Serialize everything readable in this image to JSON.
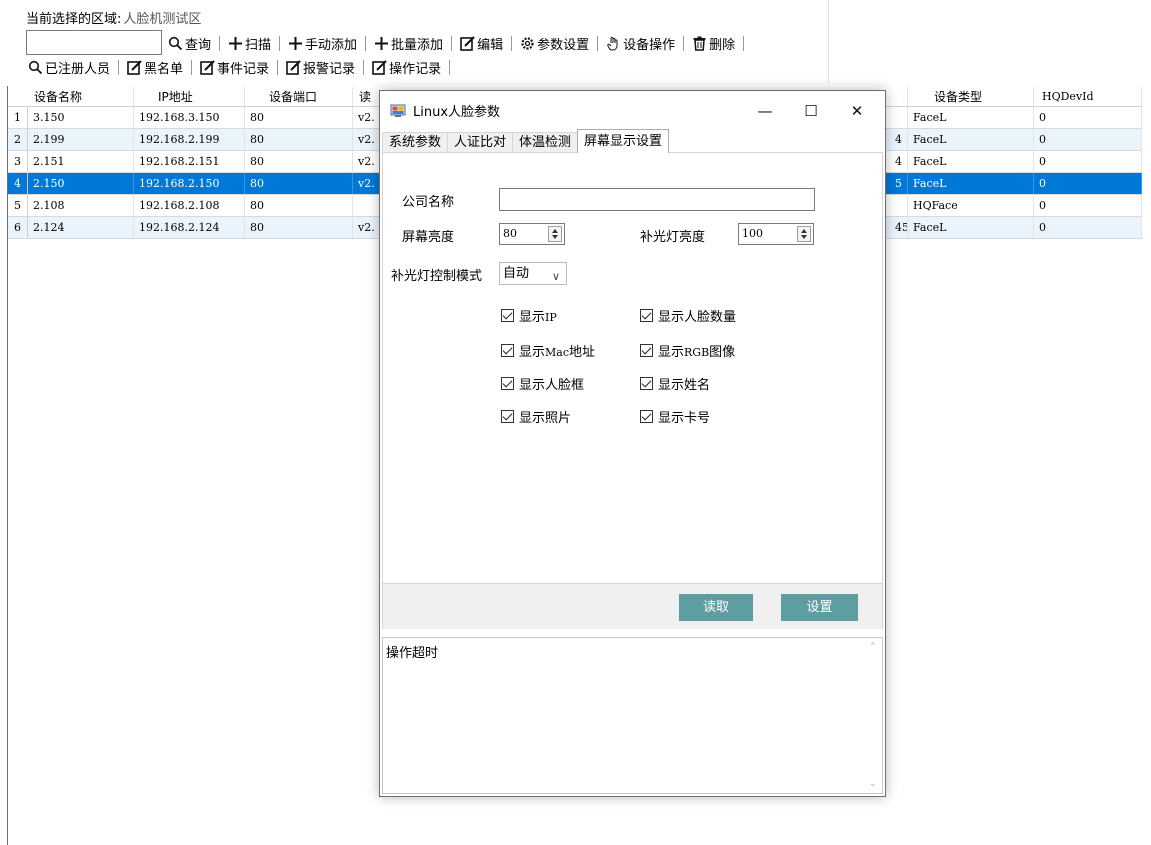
{
  "region": {
    "label": "当前选择的区域:",
    "value": "人脸机测试区"
  },
  "search": {
    "value": ""
  },
  "toolbar1": [
    {
      "icon": "search-icon",
      "label": "查询"
    },
    {
      "icon": "plus-icon",
      "label": "扫描"
    },
    {
      "icon": "plus-icon",
      "label": "手动添加"
    },
    {
      "icon": "plus-icon",
      "label": "批量添加"
    },
    {
      "icon": "edit-icon",
      "label": "编辑"
    },
    {
      "icon": "gear-icon",
      "label": "参数设置"
    },
    {
      "icon": "hand-icon",
      "label": "设备操作"
    },
    {
      "icon": "trash-icon",
      "label": "删除"
    }
  ],
  "toolbar2": [
    {
      "icon": "search-icon",
      "label": "已注册人员"
    },
    {
      "icon": "edit-icon",
      "label": "黑名单"
    },
    {
      "icon": "edit-icon",
      "label": "事件记录"
    },
    {
      "icon": "edit-icon",
      "label": "报警记录"
    },
    {
      "icon": "edit-icon",
      "label": "操作记录"
    }
  ],
  "grid": {
    "headers": {
      "name": "设备名称",
      "ip": "IP地址",
      "port": "设备端口",
      "version": "读",
      "extra": "",
      "type": "设备类型",
      "hqid": "HQDevId"
    },
    "rows": [
      {
        "num": "1",
        "name": "3.150",
        "ip": "192.168.3.150",
        "port": "80",
        "version": "v2.",
        "extra": "",
        "type": "FaceL",
        "hqid": "0"
      },
      {
        "num": "2",
        "name": "2.199",
        "ip": "192.168.2.199",
        "port": "80",
        "version": "v2.",
        "extra": "4",
        "type": "FaceL",
        "hqid": "0"
      },
      {
        "num": "3",
        "name": "2.151",
        "ip": "192.168.2.151",
        "port": "80",
        "version": "v2.",
        "extra": "4",
        "type": "FaceL",
        "hqid": "0"
      },
      {
        "num": "4",
        "name": "2.150",
        "ip": "192.168.2.150",
        "port": "80",
        "version": "v2.",
        "extra": "5",
        "type": "FaceL",
        "hqid": "0"
      },
      {
        "num": "5",
        "name": "2.108",
        "ip": "192.168.2.108",
        "port": "80",
        "version": "",
        "extra": "",
        "type": "HQFace",
        "hqid": "0"
      },
      {
        "num": "6",
        "name": "2.124",
        "ip": "192.168.2.124",
        "port": "80",
        "version": "v2.",
        "extra": "45",
        "type": "FaceL",
        "hqid": "0"
      }
    ],
    "selected_index": 3
  },
  "dialog": {
    "title": "Linux人脸参数",
    "minimize": "—",
    "maximize": "☐",
    "close": "✕",
    "tabs": [
      "系统参数",
      "人证比对",
      "体温检测",
      "屏幕显示设置"
    ],
    "active_tab": 3,
    "company_label": "公司名称",
    "company_value": "",
    "brightness_label": "屏幕亮度",
    "brightness_value": "80",
    "fill_light_label": "补光灯亮度",
    "fill_light_value": "100",
    "fill_mode_label": "补光灯控制模式",
    "fill_mode_value": "自动",
    "checkboxes": {
      "show_ip": {
        "label": "显示",
        "en": "IP",
        "checked": true
      },
      "show_face_count": {
        "label": "显示人脸数量",
        "en": "",
        "checked": true
      },
      "show_mac": {
        "label": "显示",
        "en": "Mac",
        "suffix": "地址",
        "checked": true
      },
      "show_rgb": {
        "label": "显示",
        "en": "RGB",
        "suffix": "图像",
        "checked": true
      },
      "show_face_frame": {
        "label": "显示人脸框",
        "en": "",
        "checked": true
      },
      "show_name": {
        "label": "显示姓名",
        "en": "",
        "checked": true
      },
      "show_photo": {
        "label": "显示照片",
        "en": "",
        "checked": true
      },
      "show_card": {
        "label": "显示卡号",
        "en": "",
        "checked": true
      }
    },
    "read_button": "读取",
    "set_button": "设置",
    "log_text": "操作超时"
  },
  "colors": {
    "selection": "#0078d7",
    "alt_row": "#eaf4fc",
    "flat_button": "#5f9ea0",
    "button_area": "#f0f0f0"
  }
}
